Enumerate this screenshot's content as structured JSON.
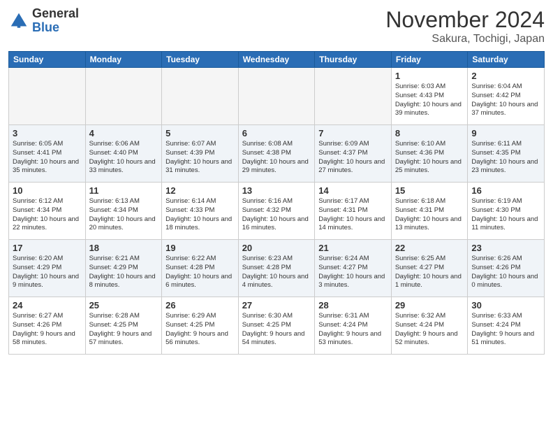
{
  "logo": {
    "general": "General",
    "blue": "Blue"
  },
  "title": "November 2024",
  "location": "Sakura, Tochigi, Japan",
  "weekdays": [
    "Sunday",
    "Monday",
    "Tuesday",
    "Wednesday",
    "Thursday",
    "Friday",
    "Saturday"
  ],
  "weeks": [
    [
      {
        "day": "",
        "info": ""
      },
      {
        "day": "",
        "info": ""
      },
      {
        "day": "",
        "info": ""
      },
      {
        "day": "",
        "info": ""
      },
      {
        "day": "",
        "info": ""
      },
      {
        "day": "1",
        "info": "Sunrise: 6:03 AM\nSunset: 4:43 PM\nDaylight: 10 hours and 39 minutes."
      },
      {
        "day": "2",
        "info": "Sunrise: 6:04 AM\nSunset: 4:42 PM\nDaylight: 10 hours and 37 minutes."
      }
    ],
    [
      {
        "day": "3",
        "info": "Sunrise: 6:05 AM\nSunset: 4:41 PM\nDaylight: 10 hours and 35 minutes."
      },
      {
        "day": "4",
        "info": "Sunrise: 6:06 AM\nSunset: 4:40 PM\nDaylight: 10 hours and 33 minutes."
      },
      {
        "day": "5",
        "info": "Sunrise: 6:07 AM\nSunset: 4:39 PM\nDaylight: 10 hours and 31 minutes."
      },
      {
        "day": "6",
        "info": "Sunrise: 6:08 AM\nSunset: 4:38 PM\nDaylight: 10 hours and 29 minutes."
      },
      {
        "day": "7",
        "info": "Sunrise: 6:09 AM\nSunset: 4:37 PM\nDaylight: 10 hours and 27 minutes."
      },
      {
        "day": "8",
        "info": "Sunrise: 6:10 AM\nSunset: 4:36 PM\nDaylight: 10 hours and 25 minutes."
      },
      {
        "day": "9",
        "info": "Sunrise: 6:11 AM\nSunset: 4:35 PM\nDaylight: 10 hours and 23 minutes."
      }
    ],
    [
      {
        "day": "10",
        "info": "Sunrise: 6:12 AM\nSunset: 4:34 PM\nDaylight: 10 hours and 22 minutes."
      },
      {
        "day": "11",
        "info": "Sunrise: 6:13 AM\nSunset: 4:34 PM\nDaylight: 10 hours and 20 minutes."
      },
      {
        "day": "12",
        "info": "Sunrise: 6:14 AM\nSunset: 4:33 PM\nDaylight: 10 hours and 18 minutes."
      },
      {
        "day": "13",
        "info": "Sunrise: 6:16 AM\nSunset: 4:32 PM\nDaylight: 10 hours and 16 minutes."
      },
      {
        "day": "14",
        "info": "Sunrise: 6:17 AM\nSunset: 4:31 PM\nDaylight: 10 hours and 14 minutes."
      },
      {
        "day": "15",
        "info": "Sunrise: 6:18 AM\nSunset: 4:31 PM\nDaylight: 10 hours and 13 minutes."
      },
      {
        "day": "16",
        "info": "Sunrise: 6:19 AM\nSunset: 4:30 PM\nDaylight: 10 hours and 11 minutes."
      }
    ],
    [
      {
        "day": "17",
        "info": "Sunrise: 6:20 AM\nSunset: 4:29 PM\nDaylight: 10 hours and 9 minutes."
      },
      {
        "day": "18",
        "info": "Sunrise: 6:21 AM\nSunset: 4:29 PM\nDaylight: 10 hours and 8 minutes."
      },
      {
        "day": "19",
        "info": "Sunrise: 6:22 AM\nSunset: 4:28 PM\nDaylight: 10 hours and 6 minutes."
      },
      {
        "day": "20",
        "info": "Sunrise: 6:23 AM\nSunset: 4:28 PM\nDaylight: 10 hours and 4 minutes."
      },
      {
        "day": "21",
        "info": "Sunrise: 6:24 AM\nSunset: 4:27 PM\nDaylight: 10 hours and 3 minutes."
      },
      {
        "day": "22",
        "info": "Sunrise: 6:25 AM\nSunset: 4:27 PM\nDaylight: 10 hours and 1 minute."
      },
      {
        "day": "23",
        "info": "Sunrise: 6:26 AM\nSunset: 4:26 PM\nDaylight: 10 hours and 0 minutes."
      }
    ],
    [
      {
        "day": "24",
        "info": "Sunrise: 6:27 AM\nSunset: 4:26 PM\nDaylight: 9 hours and 58 minutes."
      },
      {
        "day": "25",
        "info": "Sunrise: 6:28 AM\nSunset: 4:25 PM\nDaylight: 9 hours and 57 minutes."
      },
      {
        "day": "26",
        "info": "Sunrise: 6:29 AM\nSunset: 4:25 PM\nDaylight: 9 hours and 56 minutes."
      },
      {
        "day": "27",
        "info": "Sunrise: 6:30 AM\nSunset: 4:25 PM\nDaylight: 9 hours and 54 minutes."
      },
      {
        "day": "28",
        "info": "Sunrise: 6:31 AM\nSunset: 4:24 PM\nDaylight: 9 hours and 53 minutes."
      },
      {
        "day": "29",
        "info": "Sunrise: 6:32 AM\nSunset: 4:24 PM\nDaylight: 9 hours and 52 minutes."
      },
      {
        "day": "30",
        "info": "Sunrise: 6:33 AM\nSunset: 4:24 PM\nDaylight: 9 hours and 51 minutes."
      }
    ]
  ]
}
